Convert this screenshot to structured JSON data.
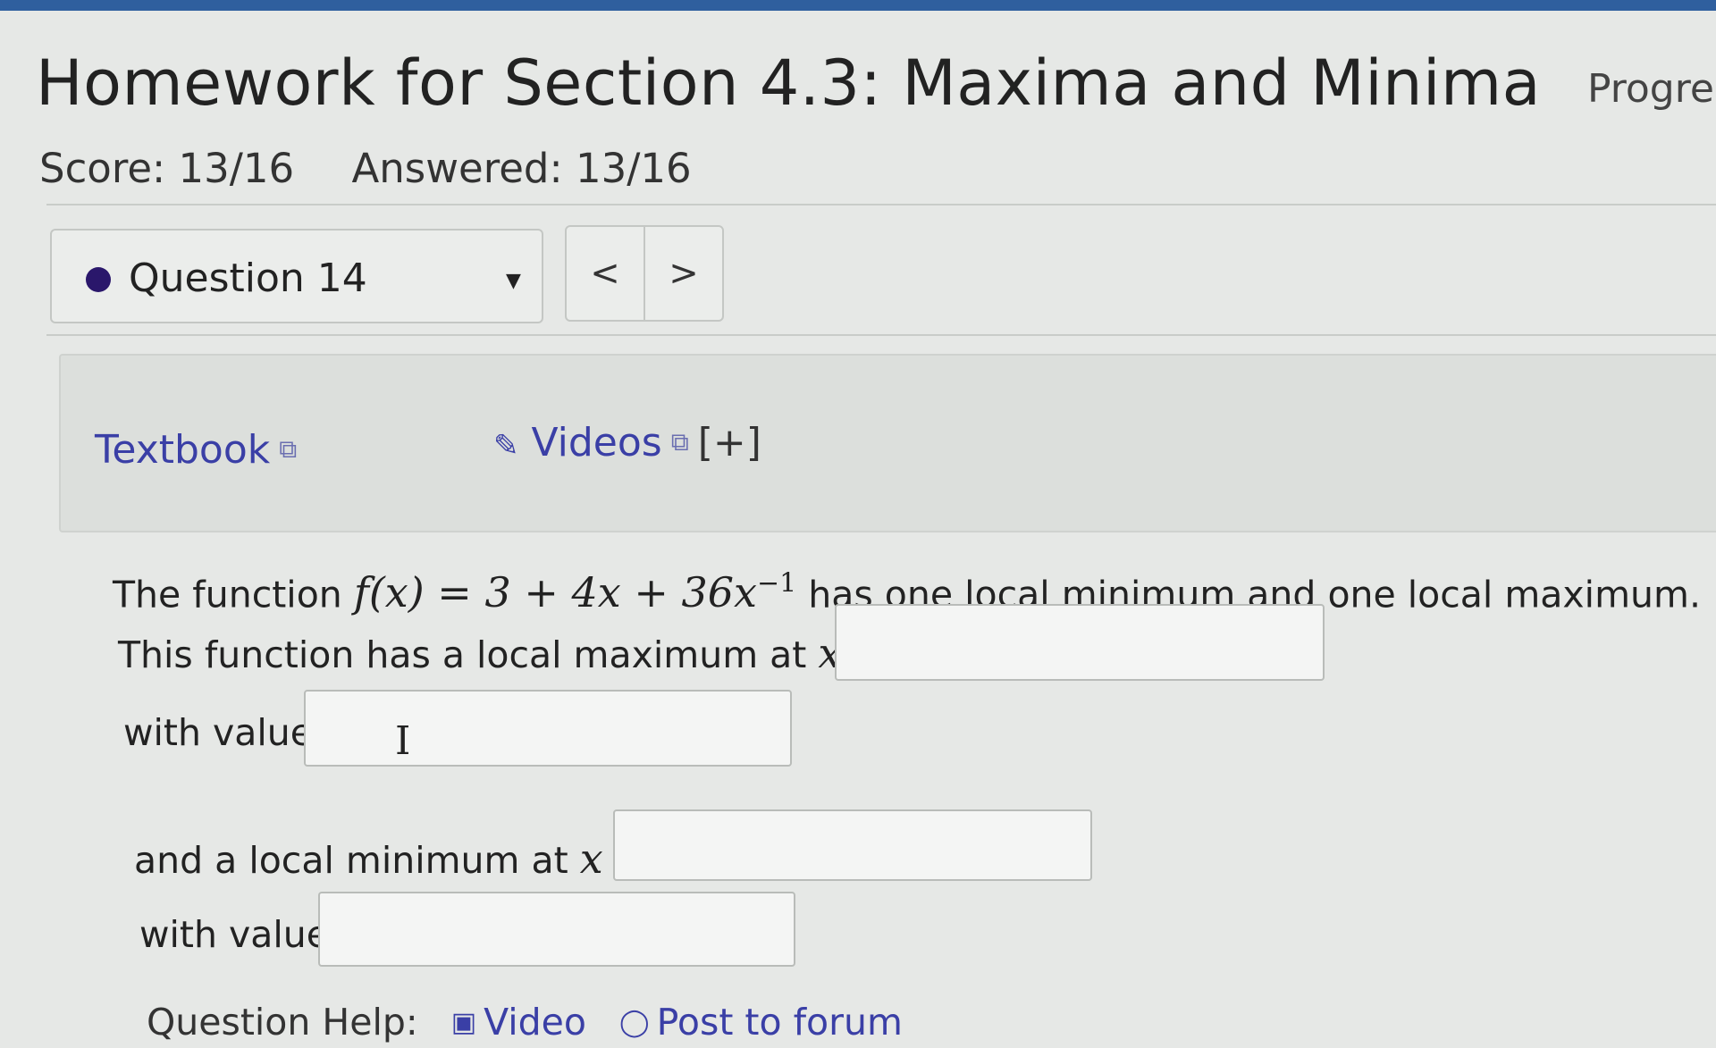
{
  "header": {
    "title": "Homework for Section 4.3: Maxima and Minima",
    "progress_label": "Progres"
  },
  "stats": {
    "score": "Score: 13/16",
    "answered": "Answered: 13/16"
  },
  "question_nav": {
    "selected": "Question 14",
    "prev": "<",
    "next": ">"
  },
  "resources": {
    "textbook": "Textbook",
    "videos": "Videos",
    "expand": "[+]"
  },
  "question": {
    "intro_prefix": "The function",
    "function_lhs": "f(x) = 3 + 4x + 36x",
    "function_exp": "−1",
    "intro_suffix": "has one local minimum and one local maximum.",
    "max_prompt": "This function has a local maximum at",
    "var_eq": "x =",
    "with_value": "with value",
    "min_prompt": "and a local minimum at"
  },
  "answers": {
    "local_max_x": "",
    "local_max_value": "",
    "local_min_x": "",
    "local_min_value": ""
  },
  "help": {
    "label": "Question Help:",
    "video": "Video",
    "forum": "Post to forum"
  },
  "colors": {
    "link": "#3a3fa6",
    "question_dot": "#2a176b",
    "topbar": "#2f5f9e"
  },
  "icons": [
    "external-link-icon",
    "paperclip-icon",
    "video-icon",
    "chat-bubble-icon",
    "caret-down-icon",
    "text-cursor-icon"
  ]
}
